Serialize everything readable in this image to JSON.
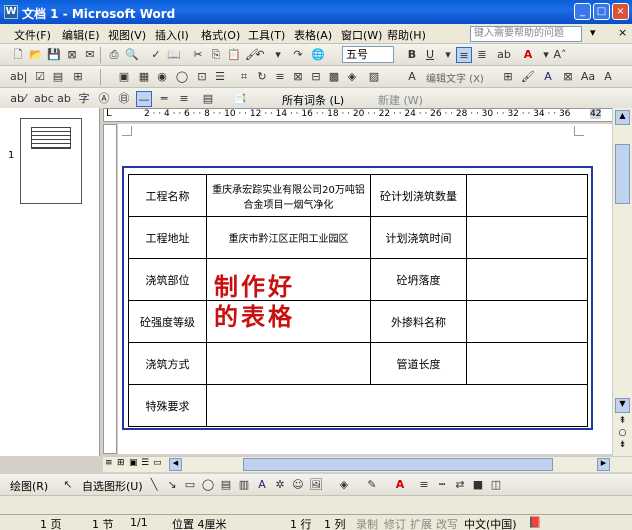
{
  "window": {
    "title": "文档 1 - Microsoft Word"
  },
  "menu": {
    "items": [
      "文件(F)",
      "编辑(E)",
      "视图(V)",
      "插入(I)",
      "格式(O)",
      "工具(T)",
      "表格(A)",
      "窗口(W)",
      "帮助(H)"
    ],
    "help_placeholder": "键入需要帮助的问题"
  },
  "toolbar": {
    "font_size": "五号",
    "style_dropdown": "所有词条 (L)",
    "new_label": "新建 (W)",
    "wordart_label": "编辑文字 (X)"
  },
  "table": {
    "rows": [
      [
        "工程名称",
        "重庆承宏踪实业有限公司20万吨铝合金项目一烟气净化",
        "砼计划浇筑数量",
        ""
      ],
      [
        "工程地址",
        "重庆市黔江区正阳工业园区",
        "计划浇筑时间",
        ""
      ],
      [
        "浇筑部位",
        "",
        "砼坍落度",
        ""
      ],
      [
        "砼强度等级",
        "",
        "外掺料名称",
        ""
      ],
      [
        "浇筑方式",
        "",
        "管道长度",
        ""
      ],
      [
        "特殊要求",
        "",
        "",
        ""
      ]
    ]
  },
  "overlay": {
    "line1": "制作好",
    "line2": "的表格"
  },
  "thumbnail": {
    "page_number": "1"
  },
  "ruler": {
    "right_value": "42"
  },
  "status": {
    "page": "1 页",
    "section": "1 节",
    "pages": "1/1",
    "position": "位置 4厘米",
    "line": "1 行",
    "col": "1 列",
    "rec": "录制",
    "trk": "修订",
    "ext": "扩展",
    "ovr": "改写",
    "lang": "中文(中国)"
  },
  "drawbar": {
    "draw": "绘图(R)",
    "autoshapes": "自选图形(U)"
  }
}
